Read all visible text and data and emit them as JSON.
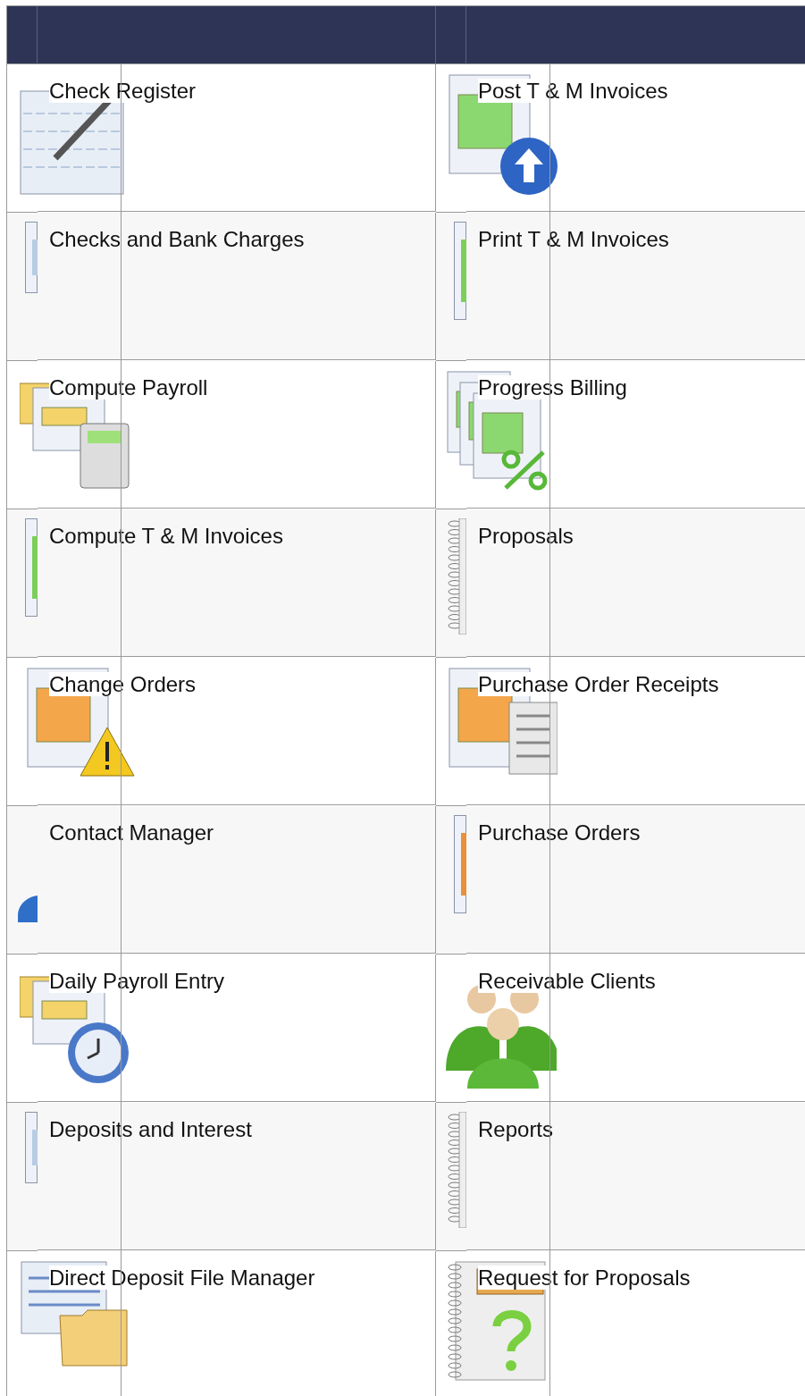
{
  "table": {
    "rows": [
      {
        "left": "Check Register",
        "right": "Post T & M Invoices"
      },
      {
        "left": "Checks and Bank Charges",
        "right": "Print T & M Invoices"
      },
      {
        "left": "Compute Payroll",
        "right": "Progress Billing"
      },
      {
        "left": "Compute T & M Invoices",
        "right": "Proposals"
      },
      {
        "left": "Change Orders",
        "right": "Purchase Order Receipts"
      },
      {
        "left": "Contact Manager",
        "right": "Purchase Orders"
      },
      {
        "left": "Daily Payroll Entry",
        "right": "Receivable Clients"
      },
      {
        "left": "Deposits and Interest",
        "right": "Reports"
      },
      {
        "left": "Direct Deposit File Manager",
        "right": "Request for Proposals"
      }
    ]
  }
}
